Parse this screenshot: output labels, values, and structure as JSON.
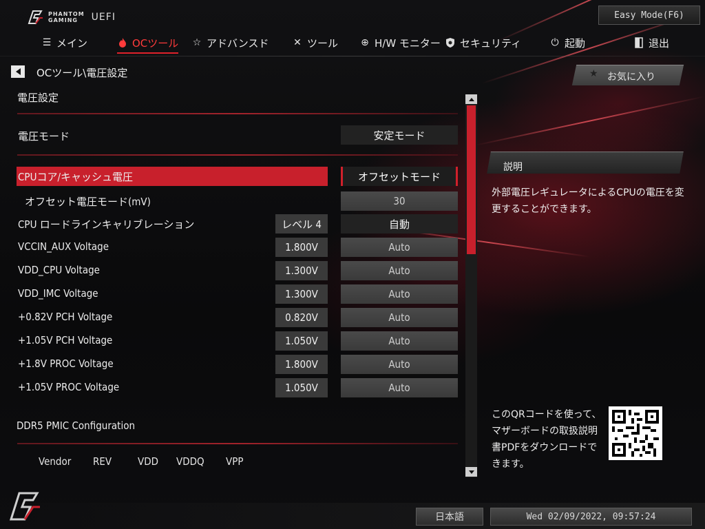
{
  "brand": {
    "line1": "PHANTOM",
    "line2": "GAMING",
    "uefi": "UEFI"
  },
  "easy_mode": "Easy Mode(F6)",
  "nav": [
    {
      "label": "メイン",
      "icon": "list-icon"
    },
    {
      "label": "OCツール",
      "icon": "flame-icon",
      "active": true
    },
    {
      "label": "アドバンスド",
      "icon": "star-icon"
    },
    {
      "label": "ツール",
      "icon": "tools-icon"
    },
    {
      "label": "H/W モニター",
      "icon": "crosshair-icon"
    },
    {
      "label": "セキュリティ",
      "icon": "shield-icon"
    },
    {
      "label": "起動",
      "icon": "power-icon"
    },
    {
      "label": "退出",
      "icon": "exit-icon"
    }
  ],
  "breadcrumb": "OCツール\\電圧設定",
  "section_title": "電圧設定",
  "voltage_mode": {
    "label": "電圧モード",
    "value": "安定モード"
  },
  "rows": [
    {
      "label": "CPUコア/キャッシュ電圧",
      "current": "",
      "option": "オフセットモード"
    },
    {
      "label": "オフセット電圧モード(mV)",
      "current": "",
      "option": "30"
    },
    {
      "label": "CPU ロードラインキャリブレーション",
      "current": "レベル 4",
      "option": "自動"
    },
    {
      "label": "VCCIN_AUX Voltage",
      "current": "1.800V",
      "option": "Auto"
    },
    {
      "label": "VDD_CPU Voltage",
      "current": "1.300V",
      "option": "Auto"
    },
    {
      "label": "VDD_IMC Voltage",
      "current": "1.300V",
      "option": "Auto"
    },
    {
      "label": "+0.82V PCH Voltage",
      "current": "0.820V",
      "option": "Auto"
    },
    {
      "label": "+1.05V PCH Voltage",
      "current": "1.050V",
      "option": "Auto"
    },
    {
      "label": "+1.8V PROC Voltage",
      "current": "1.800V",
      "option": "Auto"
    },
    {
      "label": "+1.05V PROC Voltage",
      "current": "1.050V",
      "option": "Auto"
    }
  ],
  "pmic": {
    "title": "DDR5 PMIC Configuration",
    "columns": [
      "Vendor",
      "REV",
      "VDD",
      "VDDQ",
      "VPP"
    ]
  },
  "favorites": "お気に入り",
  "description": {
    "title": "説明",
    "text": "外部電圧レギュレータによるCPUの電圧を変更することができます。"
  },
  "qr_text": "このQRコードを使って、マザーボードの取扱説明書PDFをダウンロードできます。",
  "footer": {
    "language": "日本語",
    "datetime": "Wed 02/09/2022, 09:57:24"
  },
  "colors": {
    "accent": "#c8202c",
    "active_nav": "#ff3b3b"
  }
}
